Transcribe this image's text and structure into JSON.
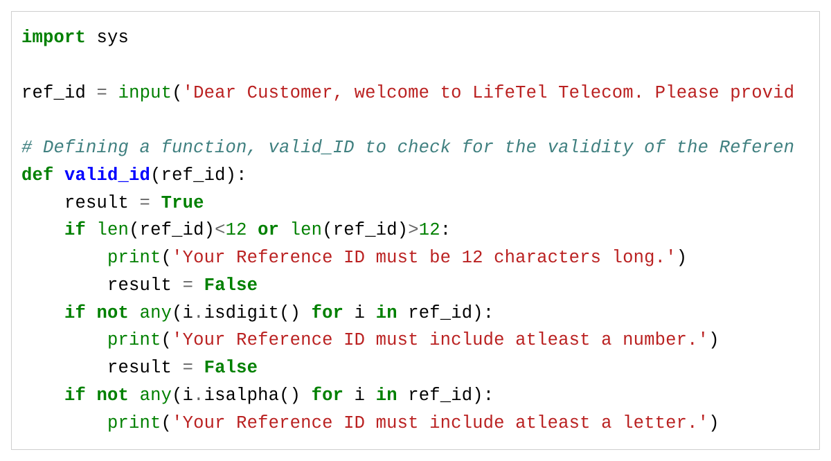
{
  "code": {
    "line1": {
      "kw_import": "import",
      "sp1": " ",
      "mod": "sys"
    },
    "line3": {
      "var": "ref_id ",
      "op_eq": "=",
      "sp": " ",
      "fn_input": "input",
      "paren_o": "(",
      "str": "'Dear Customer, welcome to LifeTel Telecom. Please provid"
    },
    "line5": {
      "comment": "# Defining a function, valid_ID to check for the validity of the Referen"
    },
    "line6": {
      "kw_def": "def",
      "sp1": " ",
      "fname": "valid_id",
      "paren_o": "(",
      "arg": "ref_id",
      "paren_c": "):"
    },
    "line7": {
      "indent": "    ",
      "var": "result ",
      "op_eq": "=",
      "sp": " ",
      "val": "True"
    },
    "line8": {
      "indent": "    ",
      "kw_if": "if",
      "sp1": " ",
      "fn_len1": "len",
      "p1": "(ref_id)",
      "op_lt": "<",
      "num1": "12",
      "sp2": " ",
      "kw_or": "or",
      "sp3": " ",
      "fn_len2": "len",
      "p2": "(ref_id)",
      "op_gt": ">",
      "num2": "12",
      "colon": ":"
    },
    "line9": {
      "indent": "        ",
      "fn_print": "print",
      "paren_o": "(",
      "str": "'Your Reference ID must be 12 characters long.'",
      "paren_c": ")"
    },
    "line10": {
      "indent": "        ",
      "var": "result ",
      "op_eq": "=",
      "sp": " ",
      "val": "False"
    },
    "line11": {
      "indent": "    ",
      "kw_if": "if",
      "sp1": " ",
      "kw_not": "not",
      "sp2": " ",
      "fn_any": "any",
      "p1": "(i",
      "op_dot": ".",
      "method": "isdigit() ",
      "kw_for": "for",
      "sp3": " i ",
      "kw_in": "in",
      "sp4": " ref_id):"
    },
    "line12": {
      "indent": "        ",
      "fn_print": "print",
      "paren_o": "(",
      "str": "'Your Reference ID must include atleast a number.'",
      "paren_c": ")"
    },
    "line13": {
      "indent": "        ",
      "var": "result ",
      "op_eq": "=",
      "sp": " ",
      "val": "False"
    },
    "line14": {
      "indent": "    ",
      "kw_if": "if",
      "sp1": " ",
      "kw_not": "not",
      "sp2": " ",
      "fn_any": "any",
      "p1": "(i",
      "op_dot": ".",
      "method": "isalpha() ",
      "kw_for": "for",
      "sp3": " i ",
      "kw_in": "in",
      "sp4": " ref_id):"
    },
    "line15": {
      "indent": "        ",
      "fn_print": "print",
      "paren_o": "(",
      "str": "'Your Reference ID must include atleast a letter.'",
      "paren_c": ")"
    }
  }
}
